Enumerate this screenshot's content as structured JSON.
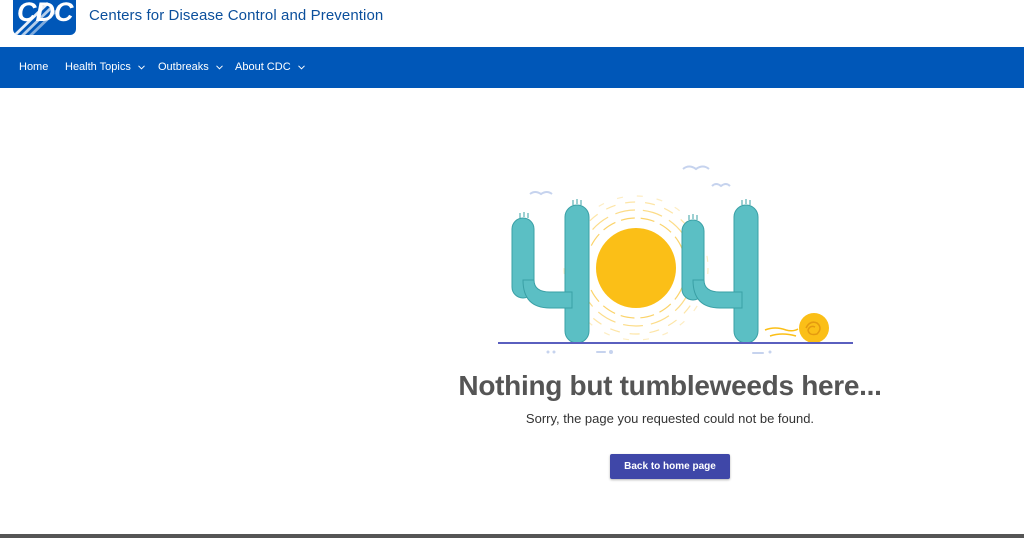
{
  "header": {
    "logo_text": "CDC",
    "site_title": "Centers for Disease Control and Prevention"
  },
  "nav": {
    "items": [
      {
        "label": "Home",
        "has_dropdown": false
      },
      {
        "label": "Health Topics",
        "has_dropdown": true
      },
      {
        "label": "Outbreaks",
        "has_dropdown": true
      },
      {
        "label": "About CDC",
        "has_dropdown": true
      }
    ]
  },
  "error_page": {
    "illustration": "404-cactus-sun-tumbleweed",
    "heading": "Nothing but tumbleweeds here...",
    "message": "Sorry, the page you requested could not be found.",
    "button_label": "Back to home page"
  },
  "colors": {
    "brand_blue": "#0057b8",
    "button_blue": "#3f47a8",
    "cactus": "#5bbfc4",
    "sun": "#fbbf17",
    "ground": "#5a5fbf"
  }
}
